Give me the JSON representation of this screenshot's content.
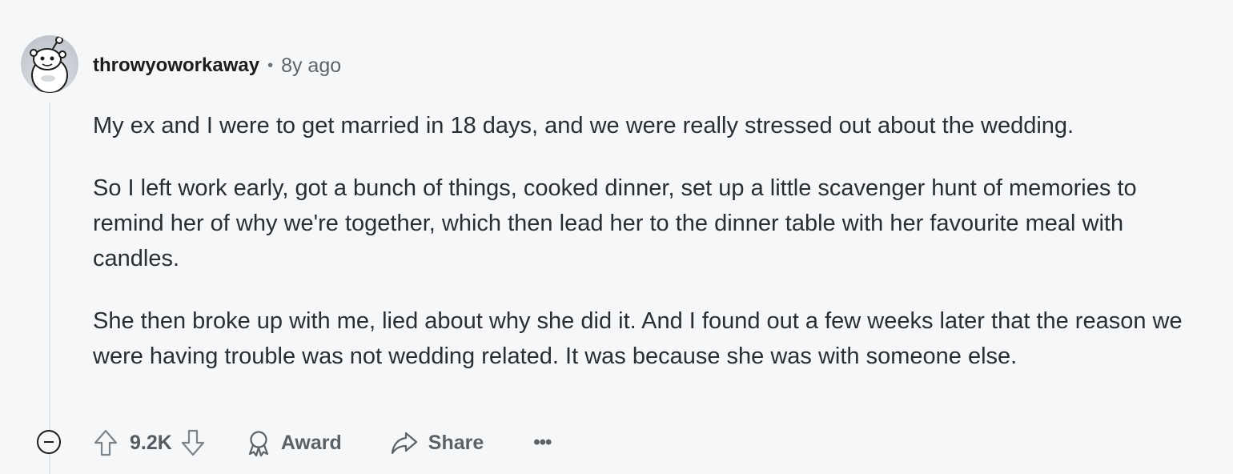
{
  "comment": {
    "author": "throwyoworkaway",
    "separator": "•",
    "time_ago": "8y ago",
    "paragraphs": [
      "My ex and I were to get married in 18 days, and we were really stressed out about the wedding.",
      "So I left work early, got a bunch of things, cooked dinner, set up a little scavenger hunt of memories to remind her of why we're together, which then lead her to the dinner table with her favourite meal with candles.",
      "She then broke up with me, lied about why she did it. And I found out a few weeks later that the reason we were having trouble was not wedding related. It was because she was with someone else."
    ]
  },
  "actions": {
    "score": "9.2K",
    "award_label": "Award",
    "share_label": "Share",
    "more_label": "•••"
  },
  "icons": {
    "avatar": "snoo-avatar-icon",
    "collapse": "collapse-minus-icon",
    "upvote": "upvote-arrow-icon",
    "downvote": "downvote-arrow-icon",
    "award": "award-ribbon-icon",
    "share": "share-arrow-icon",
    "more": "more-horizontal-icon"
  }
}
